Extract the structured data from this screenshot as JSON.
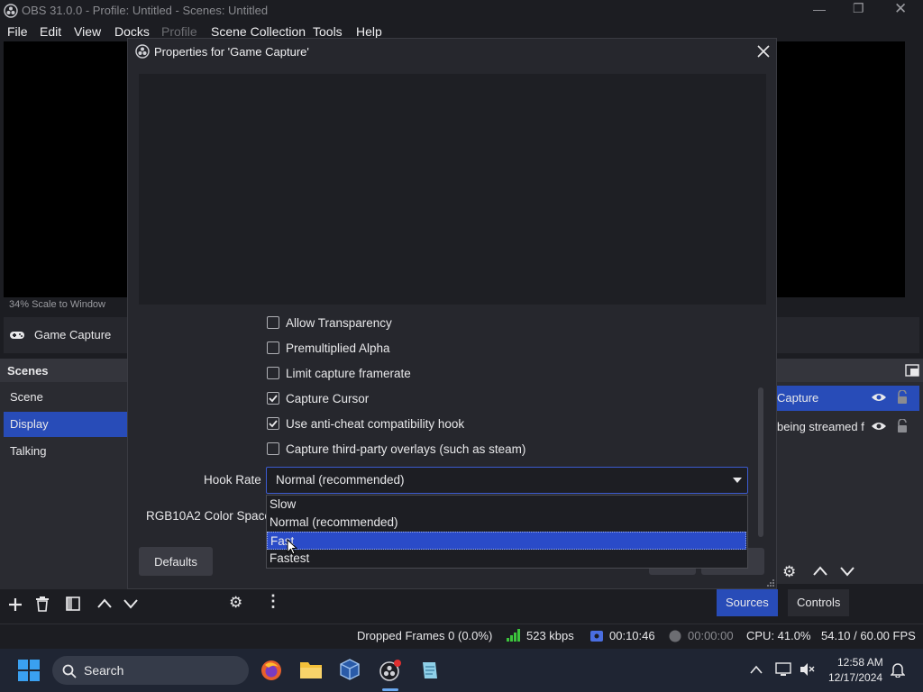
{
  "app": {
    "title": "OBS 31.0.0 - Profile: Untitled - Scenes: Untitled",
    "menu": [
      "File",
      "Edit",
      "View",
      "Docks",
      "Profile",
      "Scene Collection",
      "Tools",
      "Help"
    ]
  },
  "main": {
    "scale_label": "34%   Scale to Window",
    "current_source": "Game Capture",
    "scenes_title": "Scenes",
    "scenes": [
      "Scene",
      "Display",
      "Talking"
    ],
    "selected_scene": "Display",
    "sources": [
      "Capture",
      "being streamed f"
    ],
    "dock_tabs": [
      "Sources",
      "Controls"
    ]
  },
  "dialog": {
    "title": "Properties for 'Game Capture'",
    "checkboxes": [
      {
        "label": "Allow Transparency",
        "checked": false
      },
      {
        "label": "Premultiplied Alpha",
        "checked": false
      },
      {
        "label": "Limit capture framerate",
        "checked": false
      },
      {
        "label": "Capture Cursor",
        "checked": true
      },
      {
        "label": "Use anti-cheat compatibility hook",
        "checked": true
      },
      {
        "label": "Capture third-party overlays (such as steam)",
        "checked": false
      }
    ],
    "hook_rate_label": "Hook Rate",
    "hook_rate_value": "Normal (recommended)",
    "hook_rate_options": [
      "Slow",
      "Normal (recommended)",
      "Fast",
      "Fastest"
    ],
    "hook_rate_highlighted": "Fast",
    "rgb_label": "RGB10A2 Color Space",
    "defaults_label": "Defaults"
  },
  "status": {
    "dropped_frames": "Dropped Frames 0 (0.0%)",
    "bitrate": "523 kbps",
    "stream_time": "00:10:46",
    "record_time": "00:00:00",
    "cpu": "CPU: 41.0%",
    "fps": "54.10 / 60.00 FPS"
  },
  "taskbar": {
    "search_placeholder": "Search",
    "time": "12:58 AM",
    "date": "12/17/2024"
  },
  "colors": {
    "accent": "#284cb8",
    "highlight": "#2a4bc8",
    "bitrate_green": "#3cc43c",
    "stream_blue": "#4a6ee0"
  }
}
